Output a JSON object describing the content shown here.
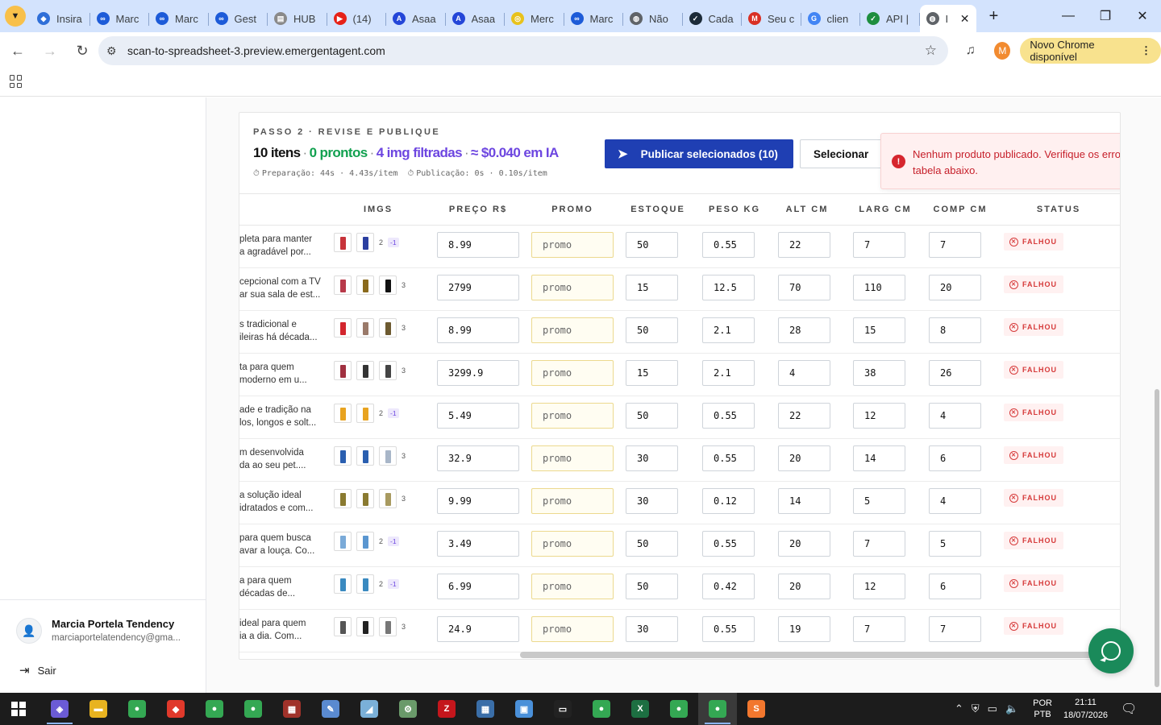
{
  "browser": {
    "tabs": [
      {
        "title": "Insira",
        "icon": "dropbox-icon",
        "color": "#2f6fd8",
        "glyph": "◆"
      },
      {
        "title": "Marc",
        "icon": "meta-icon",
        "color": "#1d5bd8",
        "glyph": "∞"
      },
      {
        "title": "Marc",
        "icon": "meta-icon",
        "color": "#1d5bd8",
        "glyph": "∞"
      },
      {
        "title": "Gest",
        "icon": "meta-icon",
        "color": "#1d5bd8",
        "glyph": "∞"
      },
      {
        "title": "HUB",
        "icon": "document-icon",
        "color": "#8a8a8a",
        "glyph": "▤"
      },
      {
        "title": "(14)",
        "icon": "youtube-icon",
        "color": "#e62117",
        "glyph": "▶"
      },
      {
        "title": "Asaa",
        "icon": "asaas-icon",
        "color": "#2446d8",
        "glyph": "A"
      },
      {
        "title": "Asaa",
        "icon": "asaas-icon",
        "color": "#2446d8",
        "glyph": "A"
      },
      {
        "title": "Merc",
        "icon": "mercado-livre-icon",
        "color": "#e8c21c",
        "glyph": "◎"
      },
      {
        "title": "Marc",
        "icon": "meta-icon",
        "color": "#1d5bd8",
        "glyph": "∞"
      },
      {
        "title": "Não",
        "icon": "globe-icon",
        "color": "#5f6368",
        "glyph": "◍"
      },
      {
        "title": "Cada",
        "icon": "app-icon",
        "color": "#1c2b39",
        "glyph": "✓"
      },
      {
        "title": "Seu c",
        "icon": "gmail-icon",
        "color": "#d93025",
        "glyph": "M"
      },
      {
        "title": "clien",
        "icon": "google-icon",
        "color": "#4285f4",
        "glyph": "G"
      },
      {
        "title": "API |",
        "icon": "app-icon",
        "color": "#1e8e3e",
        "glyph": "✓"
      }
    ],
    "active_tab": {
      "title": "I",
      "icon": "globe-icon"
    },
    "url": "scan-to-spreadsheet-3.preview.emergentagent.com",
    "profile_initial": "M",
    "update_label": "Novo Chrome disponível"
  },
  "sidebar": {
    "user_name": "Marcia Portela Tendency",
    "user_email": "marciaportelatendency@gma...",
    "logout_label": "Sair"
  },
  "step": {
    "label": "PASSO 2 · REVISE E PUBLIQUE",
    "items_count": "10 itens",
    "ready": "0 prontos",
    "filtered": "4 img filtradas",
    "cost": "≈ $0.040 em IA",
    "separator": "·",
    "prep_timing": "Preparação: 44s · 4.43s/item",
    "pub_timing": "Publicação: 0s · 0.10s/item",
    "publish_button": "Publicar selecionados (10)",
    "select_button": "Selecionar"
  },
  "toast": {
    "message": "Nenhum produto publicado. Verifique os erros na tabela abaixo."
  },
  "table": {
    "columns": [
      "IMGS",
      "PREÇO R$",
      "PROMO",
      "ESTOQUE",
      "PESO KG",
      "ALT CM",
      "LARG CM",
      "COMP CM",
      "STATUS"
    ],
    "rows": [
      {
        "desc1": "pleta para manter",
        "desc2": "a agradável por...",
        "thumbs": [
          "#c7333a",
          "#2b3fa0"
        ],
        "img_count": "2",
        "img_filtered": "-1",
        "price": "8.99",
        "promo": "promo",
        "stock": "50",
        "weight": "0.55",
        "height": "22",
        "width": "7",
        "length": "7",
        "status": "FALHOU"
      },
      {
        "desc1": "cepcional com a TV",
        "desc2": "ar sua sala de est...",
        "thumbs": [
          "#b83a4a",
          "#8a6a1c",
          "#111111"
        ],
        "img_count": "3",
        "img_filtered": "",
        "price": "2799",
        "promo": "promo",
        "stock": "15",
        "weight": "12.5",
        "height": "70",
        "width": "110",
        "length": "20",
        "status": "FALHOU"
      },
      {
        "desc1": "s tradicional e",
        "desc2": "ileiras há década...",
        "thumbs": [
          "#d3262e",
          "#9a7a6a",
          "#6d5a30"
        ],
        "img_count": "3",
        "img_filtered": "",
        "price": "8.99",
        "promo": "promo",
        "stock": "50",
        "weight": "2.1",
        "height": "28",
        "width": "15",
        "length": "8",
        "status": "FALHOU"
      },
      {
        "desc1": "ta para quem",
        "desc2": "moderno em u...",
        "thumbs": [
          "#a03040",
          "#333333",
          "#444444"
        ],
        "img_count": "3",
        "img_filtered": "",
        "price": "3299.9",
        "promo": "promo",
        "stock": "15",
        "weight": "2.1",
        "height": "4",
        "width": "38",
        "length": "26",
        "status": "FALHOU"
      },
      {
        "desc1": "ade e tradição na",
        "desc2": "los, longos e solt...",
        "thumbs": [
          "#e8a320",
          "#e8a320"
        ],
        "img_count": "2",
        "img_filtered": "-1",
        "price": "5.49",
        "promo": "promo",
        "stock": "50",
        "weight": "0.55",
        "height": "22",
        "width": "12",
        "length": "4",
        "status": "FALHOU"
      },
      {
        "desc1": "m desenvolvida",
        "desc2": "da ao seu pet....",
        "thumbs": [
          "#2a5fb0",
          "#2a5fb0",
          "#a8b6c8"
        ],
        "img_count": "3",
        "img_filtered": "",
        "price": "32.9",
        "promo": "promo",
        "stock": "30",
        "weight": "0.55",
        "height": "20",
        "width": "14",
        "length": "6",
        "status": "FALHOU"
      },
      {
        "desc1": "a solução ideal",
        "desc2": "idratados e com...",
        "thumbs": [
          "#8a7a30",
          "#8a7a30",
          "#a89a60"
        ],
        "img_count": "3",
        "img_filtered": "",
        "price": "9.99",
        "promo": "promo",
        "stock": "30",
        "weight": "0.12",
        "height": "14",
        "width": "5",
        "length": "4",
        "status": "FALHOU"
      },
      {
        "desc1": "para quem busca",
        "desc2": "avar a louça. Co...",
        "thumbs": [
          "#7aaad8",
          "#5a96d0"
        ],
        "img_count": "2",
        "img_filtered": "-1",
        "price": "3.49",
        "promo": "promo",
        "stock": "50",
        "weight": "0.55",
        "height": "20",
        "width": "7",
        "length": "5",
        "status": "FALHOU"
      },
      {
        "desc1": "a para quem",
        "desc2": "décadas de...",
        "thumbs": [
          "#3a8ac0",
          "#3a8ac0"
        ],
        "img_count": "2",
        "img_filtered": "-1",
        "price": "6.99",
        "promo": "promo",
        "stock": "50",
        "weight": "0.42",
        "height": "20",
        "width": "12",
        "length": "6",
        "status": "FALHOU"
      },
      {
        "desc1": "ideal para quem",
        "desc2": "ia a dia. Com...",
        "thumbs": [
          "#555555",
          "#222222",
          "#777777"
        ],
        "img_count": "3",
        "img_filtered": "",
        "price": "24.9",
        "promo": "promo",
        "stock": "30",
        "weight": "0.55",
        "height": "19",
        "width": "7",
        "length": "7",
        "status": "FALHOU"
      }
    ]
  },
  "taskbar": {
    "apps": [
      {
        "icon": "copilot-icon",
        "color": "#6b5bd6",
        "glyph": "◈"
      },
      {
        "icon": "file-explorer-icon",
        "color": "#e8b320",
        "glyph": "▬"
      },
      {
        "icon": "chrome-icon",
        "color": "#34a853",
        "glyph": "●"
      },
      {
        "icon": "anydesk-icon",
        "color": "#e0392b",
        "glyph": "◆"
      },
      {
        "icon": "chrome-profile-icon",
        "color": "#34a853",
        "glyph": "●"
      },
      {
        "icon": "chrome-profile-icon",
        "color": "#34a853",
        "glyph": "●"
      },
      {
        "icon": "winrar-icon",
        "color": "#a0322a",
        "glyph": "▦"
      },
      {
        "icon": "app-icon",
        "color": "#5a8ad0",
        "glyph": "✎"
      },
      {
        "icon": "app-icon",
        "color": "#7ab0d8",
        "glyph": "◢"
      },
      {
        "icon": "network-app-icon",
        "color": "#6a9a6a",
        "glyph": "⚙"
      },
      {
        "icon": "filezilla-icon",
        "color": "#c4161c",
        "glyph": "Z"
      },
      {
        "icon": "calculator-icon",
        "color": "#3a6ea8",
        "glyph": "▦"
      },
      {
        "icon": "file-icon",
        "color": "#4a90d9",
        "glyph": "▣"
      },
      {
        "icon": "terminal-icon",
        "color": "#222222",
        "glyph": "▭"
      },
      {
        "icon": "chrome-profile-icon",
        "color": "#34a853",
        "glyph": "●"
      },
      {
        "icon": "excel-icon",
        "color": "#1d6f42",
        "glyph": "X"
      },
      {
        "icon": "chrome-profile-icon",
        "color": "#34a853",
        "glyph": "●"
      },
      {
        "icon": "chrome-profile-icon",
        "color": "#34a853",
        "glyph": "●"
      },
      {
        "icon": "sublime-icon",
        "color": "#f2772e",
        "glyph": "S"
      }
    ],
    "lang_top": "POR",
    "lang_bottom": "PTB",
    "time": "21:11",
    "date": "18/07/2026"
  }
}
